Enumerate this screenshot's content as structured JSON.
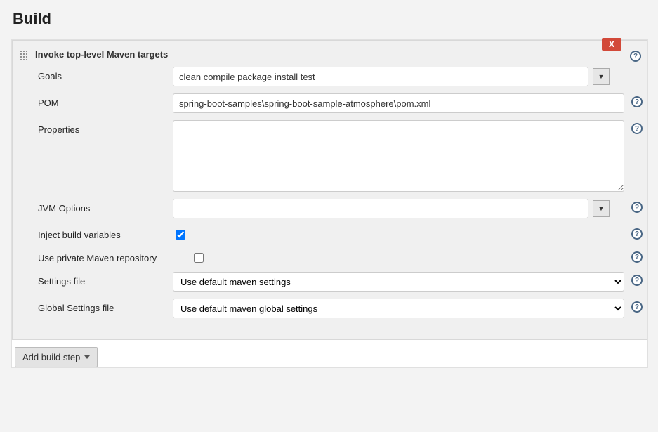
{
  "page": {
    "title": "Build"
  },
  "panel": {
    "close_label": "X",
    "title": "Invoke top-level Maven targets"
  },
  "form": {
    "goals": {
      "label": "Goals",
      "value": "clean compile package install test"
    },
    "pom": {
      "label": "POM",
      "value": "spring-boot-samples\\spring-boot-sample-atmosphere\\pom.xml"
    },
    "properties": {
      "label": "Properties",
      "value": ""
    },
    "jvm": {
      "label": "JVM Options",
      "value": ""
    },
    "inject": {
      "label": "Inject build variables",
      "checked": true
    },
    "private_repo": {
      "label": "Use private Maven repository",
      "checked": false
    },
    "settings": {
      "label": "Settings file",
      "selected": "Use default maven settings"
    },
    "global_settings": {
      "label": "Global Settings file",
      "selected": "Use default maven global settings"
    }
  },
  "footer": {
    "add_step_label": "Add build step"
  },
  "help_glyph": "?",
  "expand_glyph": "▼"
}
